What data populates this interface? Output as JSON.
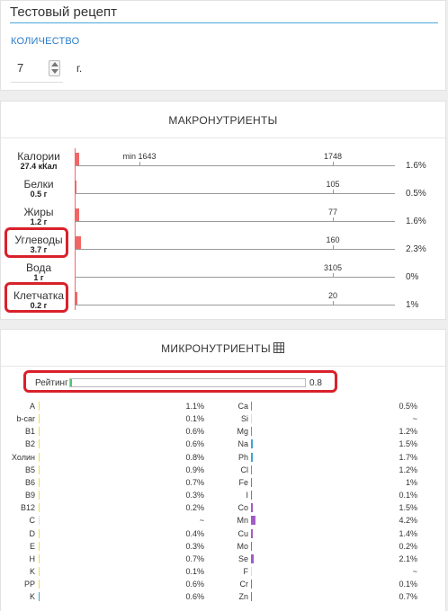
{
  "recipe": {
    "title": "Тестовый рецепт"
  },
  "quantity": {
    "label": "КОЛИЧЕСТВО",
    "value": "7",
    "unit": "г."
  },
  "macro": {
    "title": "МАКРОНУТРИЕНТЫ",
    "rows": [
      {
        "name": "Калории",
        "sub": "27.4 кКал",
        "pct": "1.6%",
        "ticks": [
          {
            "label": "min 1643"
          },
          {
            "label": "1748"
          }
        ],
        "fill": 0.016,
        "color": "#f16666"
      },
      {
        "name": "Белки",
        "sub": "0.5 г",
        "pct": "0.5%",
        "ticks": [
          {
            "label": "105"
          }
        ],
        "fill": 0.005,
        "color": "#f16666"
      },
      {
        "name": "Жиры",
        "sub": "1.2 г",
        "pct": "1.6%",
        "ticks": [
          {
            "label": "77"
          }
        ],
        "fill": 0.016,
        "color": "#f16666"
      },
      {
        "name": "Углеводы",
        "sub": "3.7 г",
        "pct": "2.3%",
        "ticks": [
          {
            "label": "160"
          }
        ],
        "fill": 0.023,
        "color": "#f16666"
      },
      {
        "name": "Вода",
        "sub": "1 г",
        "pct": "0%",
        "ticks": [
          {
            "label": "3105"
          }
        ],
        "fill": 0.0,
        "color": "#f16666"
      },
      {
        "name": "Клетчатка",
        "sub": "0.2 г",
        "pct": "1%",
        "ticks": [
          {
            "label": "20"
          }
        ],
        "fill": 0.01,
        "color": "#f16666"
      }
    ]
  },
  "micro": {
    "title": "МИКРОНУТРИЕНТЫ",
    "table_icon": "table-icon",
    "rating": {
      "label": "Рейтинг",
      "value": "0.8",
      "fill": 0.008,
      "color": "#4cc96c"
    },
    "rows": [
      {
        "left": {
          "name": "A",
          "pct": "1.1%",
          "fill": 0.011,
          "color": "#f2dc3b"
        },
        "right": {
          "name": "Ca",
          "pct": "0.5%",
          "fill": 0.005,
          "color": "#3da4d9"
        }
      },
      {
        "left": {
          "name": "b-car",
          "pct": "0.1%",
          "fill": 0.001,
          "color": "#f2dc3b"
        },
        "right": {
          "name": "Si",
          "pct": "~",
          "fill": 0,
          "color": "#3da4d9"
        }
      },
      {
        "left": {
          "name": "B1",
          "pct": "0.6%",
          "fill": 0.006,
          "color": "#f2dc3b"
        },
        "right": {
          "name": "Mg",
          "pct": "1.2%",
          "fill": 0.012,
          "color": "#3da4d9"
        }
      },
      {
        "left": {
          "name": "B2",
          "pct": "0.6%",
          "fill": 0.006,
          "color": "#f2dc3b"
        },
        "right": {
          "name": "Na",
          "pct": "1.5%",
          "fill": 0.015,
          "color": "#3da4d9"
        }
      },
      {
        "left": {
          "name": "Холин",
          "pct": "0.8%",
          "fill": 0.008,
          "color": "#f2dc3b"
        },
        "right": {
          "name": "Ph",
          "pct": "1.7%",
          "fill": 0.017,
          "color": "#3da4d9"
        }
      },
      {
        "left": {
          "name": "B5",
          "pct": "0.9%",
          "fill": 0.009,
          "color": "#f2dc3b"
        },
        "right": {
          "name": "Cl",
          "pct": "1.2%",
          "fill": 0.012,
          "color": "#3da4d9"
        }
      },
      {
        "left": {
          "name": "B6",
          "pct": "0.7%",
          "fill": 0.007,
          "color": "#f2dc3b"
        },
        "right": {
          "name": "Fe",
          "pct": "1%",
          "fill": 0.01,
          "color": "#a35bc8"
        }
      },
      {
        "left": {
          "name": "B9",
          "pct": "0.3%",
          "fill": 0.003,
          "color": "#f2dc3b"
        },
        "right": {
          "name": "I",
          "pct": "0.1%",
          "fill": 0.001,
          "color": "#a35bc8"
        }
      },
      {
        "left": {
          "name": "B12",
          "pct": "0.2%",
          "fill": 0.002,
          "color": "#f2dc3b"
        },
        "right": {
          "name": "Co",
          "pct": "1.5%",
          "fill": 0.015,
          "color": "#a35bc8"
        }
      },
      {
        "left": {
          "name": "C",
          "pct": "~",
          "fill": 0,
          "color": "#f2dc3b"
        },
        "right": {
          "name": "Mn",
          "pct": "4.2%",
          "fill": 0.042,
          "color": "#a35bc8"
        }
      },
      {
        "left": {
          "name": "D",
          "pct": "0.4%",
          "fill": 0.004,
          "color": "#f2dc3b"
        },
        "right": {
          "name": "Cu",
          "pct": "1.4%",
          "fill": 0.014,
          "color": "#a35bc8"
        }
      },
      {
        "left": {
          "name": "E",
          "pct": "0.3%",
          "fill": 0.003,
          "color": "#f2dc3b"
        },
        "right": {
          "name": "Mo",
          "pct": "0.2%",
          "fill": 0.002,
          "color": "#a35bc8"
        }
      },
      {
        "left": {
          "name": "H",
          "pct": "0.7%",
          "fill": 0.007,
          "color": "#f2dc3b"
        },
        "right": {
          "name": "Se",
          "pct": "2.1%",
          "fill": 0.021,
          "color": "#a35bc8"
        }
      },
      {
        "left": {
          "name": "K",
          "pct": "0.1%",
          "fill": 0.001,
          "color": "#f2dc3b"
        },
        "right": {
          "name": "F",
          "pct": "~",
          "fill": 0,
          "color": "#a35bc8"
        }
      },
      {
        "left": {
          "name": "PP",
          "pct": "0.6%",
          "fill": 0.006,
          "color": "#f2dc3b"
        },
        "right": {
          "name": "Cr",
          "pct": "0.1%",
          "fill": 0.001,
          "color": "#a35bc8"
        }
      },
      {
        "left": {
          "name": "K",
          "pct": "0.6%",
          "fill": 0.006,
          "color": "#3da4d9"
        },
        "right": {
          "name": "Zn",
          "pct": "0.7%",
          "fill": 0.007,
          "color": "#a35bc8"
        }
      }
    ]
  }
}
